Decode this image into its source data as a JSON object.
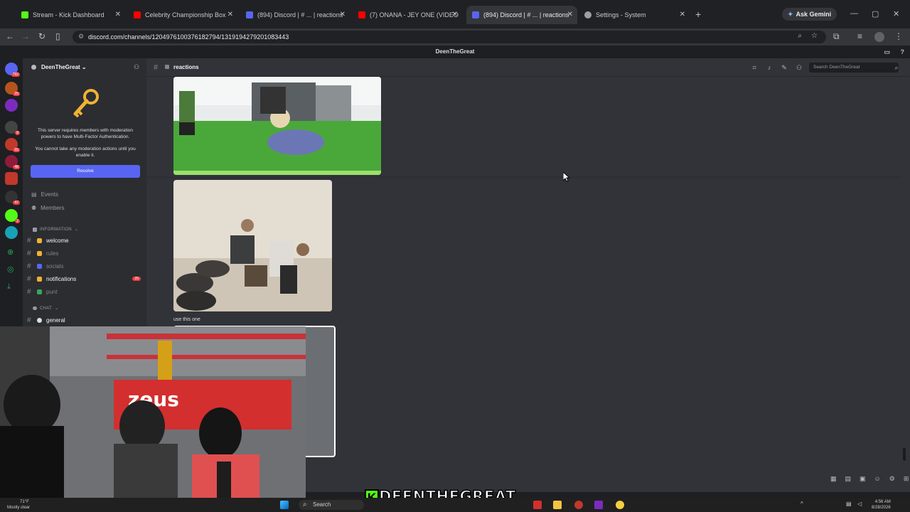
{
  "browser": {
    "tabs": [
      {
        "label": "Stream - Kick Dashboard",
        "color": "#53fc18",
        "active": false
      },
      {
        "label": "Celebrity Championship Box",
        "color": "#ff0000",
        "active": false
      },
      {
        "label": "(894) Discord | # ... | reactions",
        "color": "#5865f2",
        "active": false
      },
      {
        "label": "(7) ONANA - JEY ONE (VIDEO",
        "color": "#ff0000",
        "active": false
      },
      {
        "label": "(894) Discord | # ... | reactions",
        "color": "#5865f2",
        "active": true
      },
      {
        "label": "Settings - System",
        "color": "#9aa0a6",
        "active": false
      }
    ],
    "ask_gemini": "Ask Gemini",
    "url": "discord.com/channels/1204976100376182794/1319194279201083443"
  },
  "discord": {
    "window_title": "DeenTheGreat",
    "server_name": "DeenTheGreat",
    "mfa_notice": "This server requires members with moderation powers to have Multi-Factor Authentication.",
    "mfa_sub": "You cannot take any moderation actions until you enable it.",
    "resolve_label": "Resolve",
    "nav": {
      "events": "Events",
      "members": "Members"
    },
    "categories": {
      "information": "INFORMATION",
      "chat": "CHAT"
    },
    "channels": [
      {
        "name": "welcome",
        "unread": true,
        "emoji_color": "#f0b232"
      },
      {
        "name": "rules",
        "unread": false,
        "emoji_color": "#f0b232"
      },
      {
        "name": "socials",
        "unread": false,
        "emoji_color": "#5865f2"
      },
      {
        "name": "notifications",
        "unread": true,
        "emoji_color": "#f0b232",
        "mentions": "25"
      },
      {
        "name": "punt",
        "unread": false,
        "emoji_color": "#3ba55d"
      },
      {
        "name": "general",
        "unread": true,
        "emoji_color": "#dbdee1"
      }
    ],
    "channel_header": "reactions",
    "search_placeholder": "Search DeenTheGreat",
    "message_text": "use this one",
    "server_badges": [
      "792",
      "25",
      "",
      "8",
      "65",
      "48",
      "",
      "47",
      "2"
    ]
  },
  "stream_overlay": {
    "logo_text": "DEENTHEGREAT",
    "logo_k": "K"
  },
  "taskbar": {
    "temperature": "71°F",
    "weather": "Mostly clear",
    "search_label": "Search",
    "time": "4:56 AM",
    "date": "8/28/2026"
  }
}
